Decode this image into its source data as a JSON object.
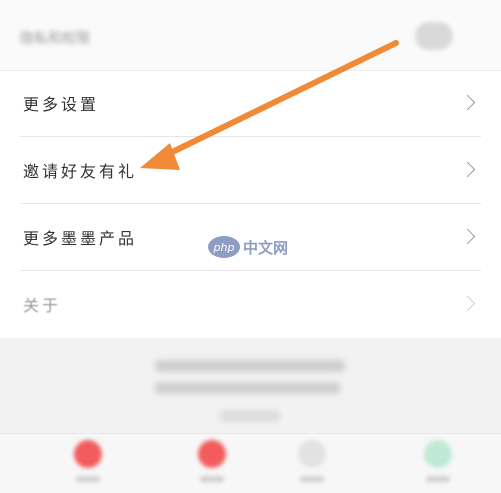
{
  "header": {
    "blurred_label": "隐私和权限",
    "toggle_icon": "toggle-icon"
  },
  "menu": {
    "items": [
      {
        "label": "更多设置",
        "icon": "chevron-right-icon"
      },
      {
        "label": "邀请好友有礼",
        "icon": "chevron-right-icon"
      },
      {
        "label": "更多墨墨产品",
        "icon": "chevron-right-icon"
      },
      {
        "label": "关于",
        "icon": "chevron-right-icon"
      }
    ]
  },
  "watermark": {
    "logo": "php",
    "text": "中文网"
  },
  "annotation": {
    "color": "#f08a36",
    "target": "邀请好友有礼"
  },
  "colors": {
    "text_primary": "#333333",
    "divider": "#e6e6e6",
    "chevron": "#9b9b9b",
    "tab_accent": "#f25c5c",
    "tab_green": "#7fd4b0"
  },
  "tabbar": {
    "tabs": [
      {
        "icon": "tab-icon-1",
        "color": "#f25c5c"
      },
      {
        "icon": "tab-icon-2",
        "color": "#f25c5c"
      },
      {
        "icon": "tab-icon-3",
        "color": "#cfcfcf"
      },
      {
        "icon": "tab-icon-4",
        "color": "#7fd4b0"
      }
    ]
  }
}
